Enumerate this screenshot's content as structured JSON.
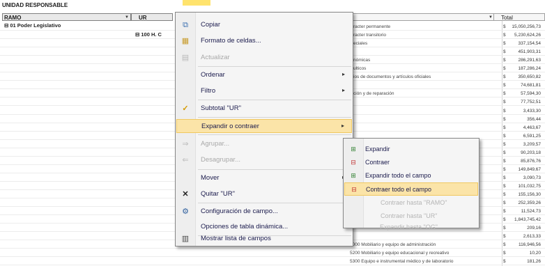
{
  "pivot": {
    "header": "UNIDAD RESPONSABLE",
    "filter_ramo": "RAMO",
    "filter_ur": "UR",
    "filter_total": "Total",
    "ramo_value": "01 Poder Legislativo",
    "ur_value": "100 H. C",
    "descriptions": [
      "racter permanente",
      "racter transitorio",
      "eciales",
      "",
      "nómicas",
      "ulticos",
      "ios de documentos y artículos oficiales",
      "",
      "ción y de reparación",
      "",
      "",
      "",
      "",
      "",
      "",
      "",
      "",
      "",
      "",
      "",
      "",
      "",
      "",
      "",
      "",
      "",
      "5000 Mobiliario y equipo de administración",
      "5200 Mobiliario y equipo educacional y recreativo",
      "5300 Equipo e instrumental médico y de laboratorio"
    ],
    "values": [
      "15,050,256,73",
      "5,230,624,26",
      "337,154,54",
      "451,903,31",
      "286,291,63",
      "187,286,24",
      "350,650,82",
      "74,681,81",
      "57,594,30",
      "77,752,51",
      "3,433,30",
      "356,44",
      "4,463,67",
      "6,591,25",
      "3,209,57",
      "90,203,18",
      "85,876,76",
      "149,849,67",
      "3,090,73",
      "101,032,75",
      "155,156,30",
      "252,359,26",
      "11,524,73",
      "1,843,745,42",
      "209,16",
      "2,613,33",
      "116,946,56",
      "10,20",
      "181,26"
    ],
    "currency": "$"
  },
  "context_menu": {
    "copy": "Copiar",
    "format_cells": "Formato de celdas...",
    "refresh": "Actualizar",
    "sort": "Ordenar",
    "filter": "Filtro",
    "subtotal": "Subtotal \"UR\"",
    "expand_collapse": "Expandir o contraer",
    "group": "Agrupar...",
    "ungroup": "Desagrupar...",
    "move": "Mover",
    "remove": "Quitar \"UR\"",
    "field_settings": "Configuración de campo...",
    "pivot_options": "Opciones de tabla dinámica...",
    "show_field_list": "Mostrar lista de campos"
  },
  "submenu": {
    "expand": "Expandir",
    "collapse": "Contraer",
    "expand_entire": "Expandir todo el campo",
    "collapse_entire": "Contraer todo el campo",
    "collapse_to_ramo": "Contraer hasta \"RAMO\"",
    "collapse_to_ur": "Contraer hasta \"UR\"",
    "expand_to_og": "Expandir hasta \"OG\""
  },
  "icons": {
    "copy": "copy-icon",
    "format": "format-cells-icon",
    "refresh": "refresh-icon",
    "check": "checkmark-icon",
    "remove": "remove-x-icon",
    "field": "field-settings-icon",
    "list": "field-list-icon",
    "expand": "expand-icon",
    "collapse": "collapse-icon"
  },
  "colors": {
    "highlight": "#fbe4a8",
    "highlight_border": "#f0c860",
    "menu_bg": "#f5f5f5",
    "menu_text": "#1a1a4c",
    "disabled_text": "#a8a8a8"
  }
}
